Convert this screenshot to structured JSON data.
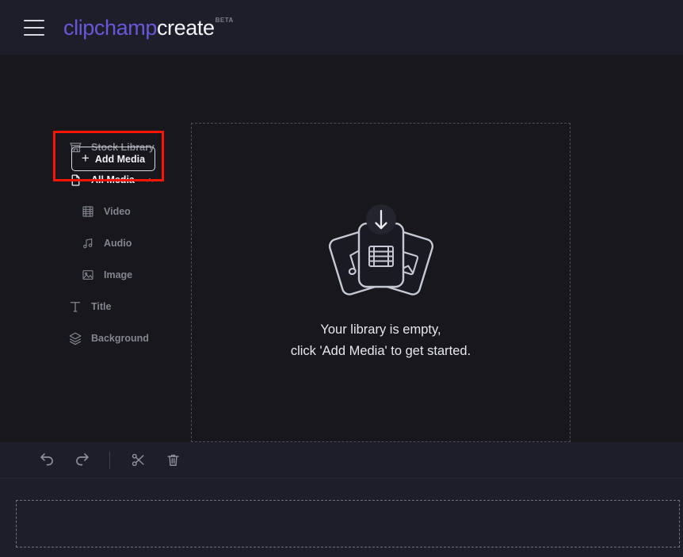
{
  "header": {
    "menu_icon": "hamburger-icon",
    "brand_part1": "clipchamp",
    "brand_part2": "create",
    "brand_badge": "BETA",
    "brand_color": "#6758d9"
  },
  "sidebar": {
    "add_media": {
      "label": "Add Media",
      "plus": "+",
      "highlight_color": "#fb1505"
    },
    "items": [
      {
        "label": "Stock Library",
        "icon": "store-icon",
        "active": false,
        "level": 0
      },
      {
        "label": "All Media",
        "icon": "document-icon",
        "active": true,
        "level": 0,
        "chevron": "chevron-up-icon"
      },
      {
        "label": "Video",
        "icon": "film-icon",
        "active": false,
        "level": 1
      },
      {
        "label": "Audio",
        "icon": "music-note-icon",
        "active": false,
        "level": 1
      },
      {
        "label": "Image",
        "icon": "image-icon",
        "active": false,
        "level": 1
      },
      {
        "label": "Title",
        "icon": "text-icon",
        "active": false,
        "level": 0
      },
      {
        "label": "Background",
        "icon": "layers-icon",
        "active": false,
        "level": 0
      }
    ]
  },
  "main": {
    "dropzone": {
      "illustration": "media-cards-upload-icon",
      "line1": "Your library is empty,",
      "line2": "click 'Add Media' to get started."
    }
  },
  "timeline": {
    "tools": [
      {
        "name": "undo-button",
        "icon": "undo-arrow-icon"
      },
      {
        "name": "redo-button",
        "icon": "redo-arrow-icon"
      },
      {
        "name": "toolbar-divider",
        "icon": "divider"
      },
      {
        "name": "split-button",
        "icon": "scissors-icon"
      },
      {
        "name": "delete-button",
        "icon": "trash-icon"
      }
    ]
  }
}
